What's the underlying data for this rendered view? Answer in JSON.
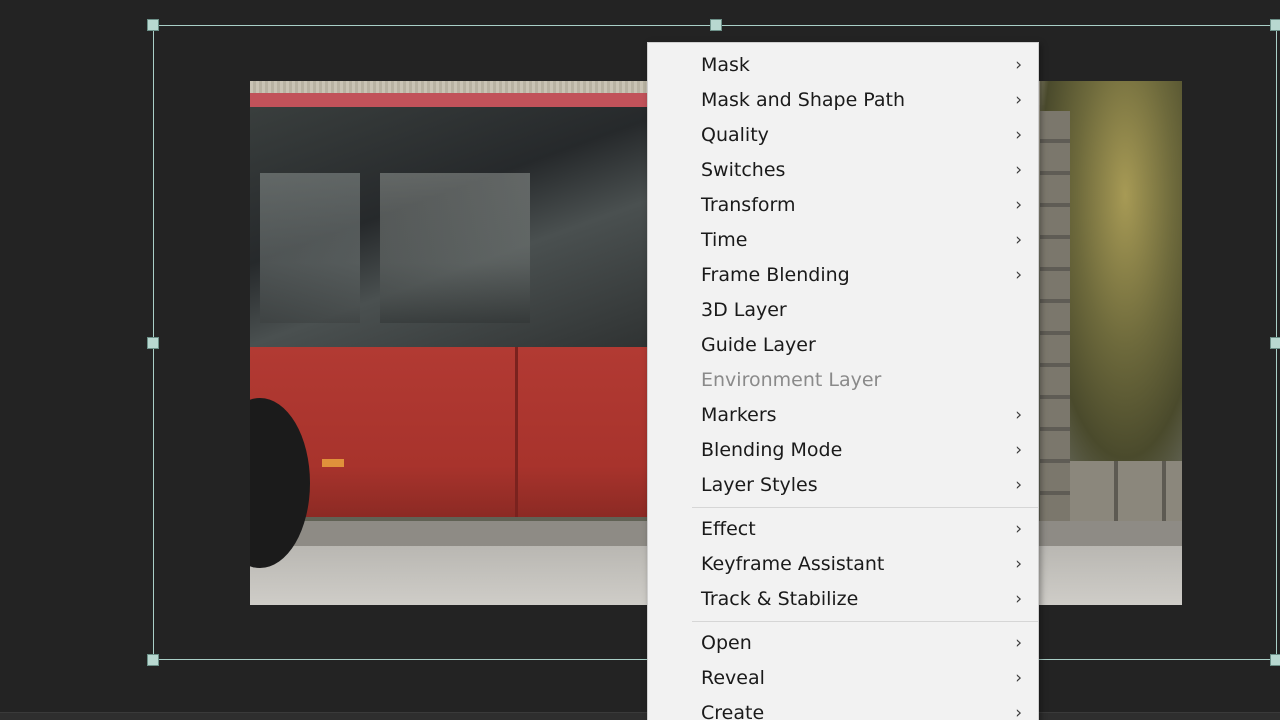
{
  "menu": {
    "group1": [
      {
        "label": "Mask",
        "submenu": true,
        "enabled": true
      },
      {
        "label": "Mask and Shape Path",
        "submenu": true,
        "enabled": true
      },
      {
        "label": "Quality",
        "submenu": true,
        "enabled": true
      },
      {
        "label": "Switches",
        "submenu": true,
        "enabled": true
      },
      {
        "label": "Transform",
        "submenu": true,
        "enabled": true
      },
      {
        "label": "Time",
        "submenu": true,
        "enabled": true
      },
      {
        "label": "Frame Blending",
        "submenu": true,
        "enabled": true
      },
      {
        "label": "3D Layer",
        "submenu": false,
        "enabled": true
      },
      {
        "label": "Guide Layer",
        "submenu": false,
        "enabled": true
      },
      {
        "label": "Environment Layer",
        "submenu": false,
        "enabled": false
      },
      {
        "label": "Markers",
        "submenu": true,
        "enabled": true
      },
      {
        "label": "Blending Mode",
        "submenu": true,
        "enabled": true
      },
      {
        "label": "Layer Styles",
        "submenu": true,
        "enabled": true
      }
    ],
    "group2": [
      {
        "label": "Effect",
        "submenu": true,
        "enabled": true
      },
      {
        "label": "Keyframe Assistant",
        "submenu": true,
        "enabled": true
      },
      {
        "label": "Track & Stabilize",
        "submenu": true,
        "enabled": true
      }
    ],
    "group3": [
      {
        "label": "Open",
        "submenu": true,
        "enabled": true
      },
      {
        "label": "Reveal",
        "submenu": true,
        "enabled": true
      },
      {
        "label": "Create",
        "submenu": true,
        "enabled": true
      }
    ],
    "chevron_glyph": "›"
  },
  "colors": {
    "menu_bg": "#f2f2f2",
    "menu_text": "#1a1a1a",
    "menu_disabled_text": "#8a8a8a",
    "selection_outline": "#a9cfc7",
    "viewer_bg": "#232323"
  },
  "icons": {
    "submenu": "chevron-right-icon",
    "handle": "transform-handle"
  }
}
